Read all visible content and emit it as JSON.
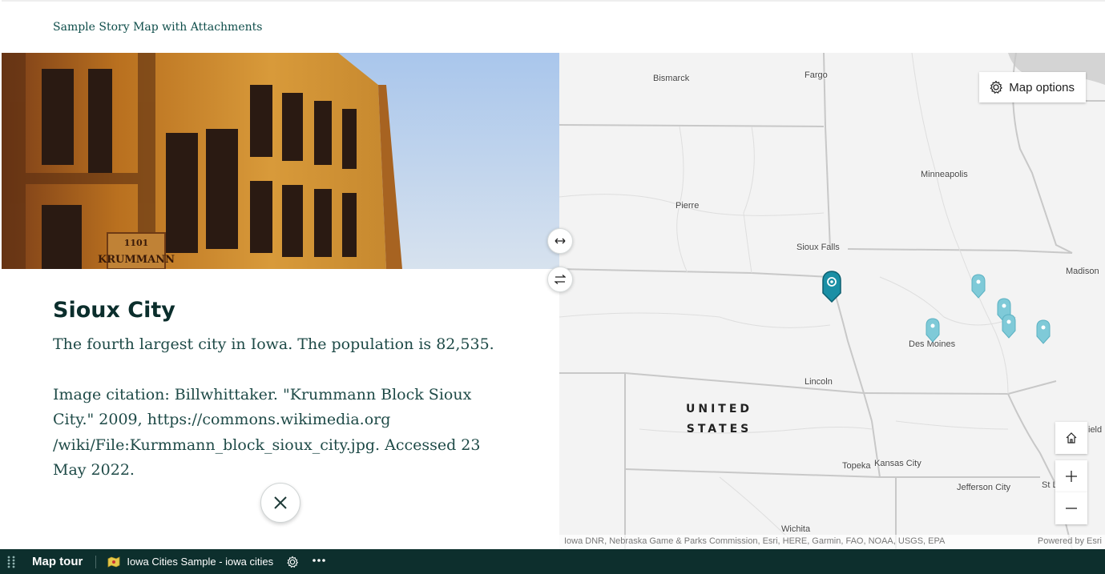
{
  "header": {
    "story_title": "Sample Story Map with Attachments"
  },
  "panel": {
    "photo_alt": "Krummann Block Sioux City",
    "photo_sign_text": "KRUMMANN",
    "photo_sign_number": "1101",
    "place_title": "Sioux City",
    "description": "The fourth largest city in Iowa. The population is 82,535.",
    "citation": "Image citation: Billwhittaker. \"Krummann Block Sioux City.\" 2009, https://commons.wikimedia.org /wiki/File:Kurmmann_block_sioux_city.jpg. Accessed 23 May 2022."
  },
  "map": {
    "options_label": "Map options",
    "cities": {
      "bismarck": "Bismarck",
      "fargo": "Fargo",
      "minneapolis": "Minneapolis",
      "pierre": "Pierre",
      "sioux_falls": "Sioux Falls",
      "madison": "Madison",
      "des_moines": "Des Moines",
      "lincoln": "Lincoln",
      "topeka": "Topeka",
      "kansas_city": "Kansas City",
      "jefferson_city": "Jefferson City",
      "wichita": "Wichita",
      "st_l": "St L",
      "springfield_partial": "ield"
    },
    "country_line1": "UNITED",
    "country_line2": "STATES",
    "attribution": "Iowa DNR, Nebraska Game & Parks Commission, Esri, HERE, Garmin, FAO, NOAA, USGS, EPA",
    "powered_by": "Powered by Esri",
    "colors": {
      "pin_active": "#1a8fa5",
      "pin": "#7fcad8"
    }
  },
  "footer": {
    "app_name": "Map tour",
    "item_name": "Iowa Cities Sample - iowa cities"
  }
}
